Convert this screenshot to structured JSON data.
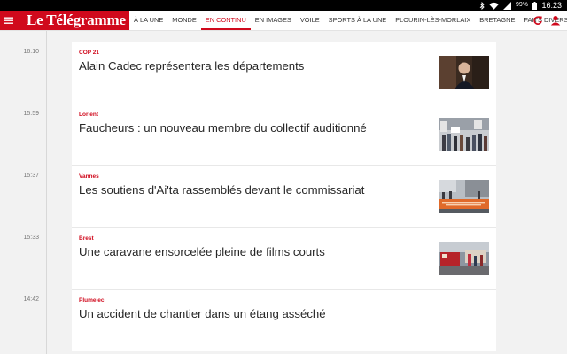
{
  "status_bar": {
    "battery": "99%",
    "time": "16:23"
  },
  "app": {
    "logo": "Le Télégramme"
  },
  "tabs": [
    {
      "label": "À LA UNE",
      "active": false
    },
    {
      "label": "MONDE",
      "active": false
    },
    {
      "label": "EN CONTINU",
      "active": true
    },
    {
      "label": "EN IMAGES",
      "active": false
    },
    {
      "label": "VOILE",
      "active": false
    },
    {
      "label": "SPORTS À LA UNE",
      "active": false
    },
    {
      "label": "PLOURIN-LÈS-MORLAIX",
      "active": false
    },
    {
      "label": "BRETAGNE",
      "active": false
    },
    {
      "label": "FAITS DIVERS",
      "active": false
    }
  ],
  "articles": [
    {
      "time": "16:10",
      "kicker": "COP 21",
      "headline": "Alain Cadec représentera les départements",
      "thumbnail": true
    },
    {
      "time": "15:59",
      "kicker": "Lorient",
      "headline": "Faucheurs : un nouveau membre du collectif auditionné",
      "thumbnail": true
    },
    {
      "time": "15:37",
      "kicker": "Vannes",
      "headline": "Les soutiens d'Ai'ta rassemblés devant le commissariat",
      "thumbnail": true
    },
    {
      "time": "15:33",
      "kicker": "Brest",
      "headline": "Une caravane ensorcelée pleine de films courts",
      "thumbnail": true
    },
    {
      "time": "14:42",
      "kicker": "Plumelec",
      "headline": "Un accident de chantier dans un étang asséché",
      "thumbnail": false
    }
  ],
  "colors": {
    "brand_red": "#d0091c",
    "background": "#f2f2f2",
    "card": "#ffffff"
  }
}
